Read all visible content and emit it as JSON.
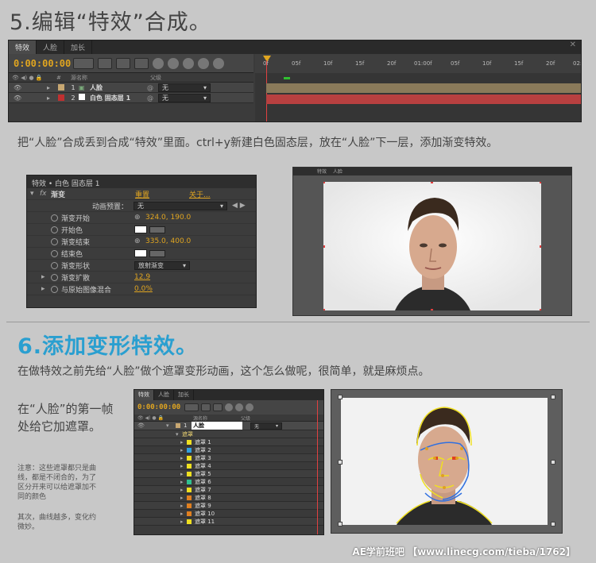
{
  "step5": {
    "title": "5.编辑“特效”合成。",
    "description": "把“人脸”合成丢到合成“特效”里面。ctrl+y新建白色固态层，放在“人脸”下一层，添加渐变特效。"
  },
  "timeline1": {
    "tabs": [
      "特效",
      "人脸",
      "加长"
    ],
    "timecode": "0:00:00:00",
    "col_source": "源名称",
    "col_parent": "父级",
    "ruler_ticks": [
      "0f",
      "05f",
      "10f",
      "15f",
      "20f",
      "01:00f",
      "05f",
      "10f",
      "15f",
      "20f",
      "02:0"
    ],
    "layers": [
      {
        "num": "1",
        "name": "人脸",
        "parent": "无",
        "color": "#c8a872",
        "track": "#8a7a5a"
      },
      {
        "num": "2",
        "name": "白色 固态层 1",
        "parent": "无",
        "color": "#c03030",
        "track": "#b84040"
      }
    ]
  },
  "effect_controls": {
    "header": "特效 • 白色 固态层 1",
    "effect_name": "渐变",
    "reset": "重置",
    "about": "关于...",
    "preset_label": "动画预置：",
    "preset_value": "无",
    "rows": [
      {
        "label": "渐变开始",
        "value": "324.0, 190.0",
        "kind": "point"
      },
      {
        "label": "开始色",
        "value": "",
        "kind": "color"
      },
      {
        "label": "渐变结束",
        "value": "335.0, 400.0",
        "kind": "point"
      },
      {
        "label": "结束色",
        "value": "",
        "kind": "color"
      },
      {
        "label": "渐变形状",
        "value": "放射渐变",
        "kind": "dropdown"
      },
      {
        "label": "渐变扩散",
        "value": "12.9",
        "kind": "num"
      },
      {
        "label": "与原始图像混合",
        "value": "0.0%",
        "kind": "num"
      }
    ]
  },
  "viewer1": {
    "tabs": [
      "特效",
      "人脸"
    ]
  },
  "step6": {
    "title": "6.添加变形特效。",
    "description": "在做特效之前先给“人脸”做个遮罩变形动画，这个怎么做呢，很简单，就是麻烦点。",
    "side_text": "在“人脸”的第一帧处给它加遮罩。",
    "note1": "注意：这些遮罩都只是曲线，都是不闭合的，为了区分开来可以给遮罩加不同的颜色",
    "note2": "其次，曲线越多，变化约微妙。"
  },
  "timeline2": {
    "tabs": [
      "特效",
      "人脸",
      "加长"
    ],
    "timecode": "0:00:00:00",
    "col_source": "源名称",
    "col_parent": "父级",
    "layer_name": "人脸",
    "layer_num": "1",
    "parent": "无",
    "mask_group": "遮罩",
    "masks": [
      {
        "name": "遮罩 1",
        "color": "#f0e020"
      },
      {
        "name": "遮罩 2",
        "color": "#30a0e0"
      },
      {
        "name": "遮罩 3",
        "color": "#f0e020"
      },
      {
        "name": "遮罩 4",
        "color": "#f0e020"
      },
      {
        "name": "遮罩 5",
        "color": "#f0e020"
      },
      {
        "name": "遮罩 6",
        "color": "#30c090"
      },
      {
        "name": "遮罩 7",
        "color": "#f0e020"
      },
      {
        "name": "遮罩 8",
        "color": "#e08020"
      },
      {
        "name": "遮罩 9",
        "color": "#e08020"
      },
      {
        "name": "遮罩 10",
        "color": "#e08020"
      },
      {
        "name": "遮罩 11",
        "color": "#f0e020"
      }
    ]
  },
  "footer": "AE学前班吧 【www.linecg.com/tieba/1762】",
  "colors": {
    "accent_blue": "#2a9fd0",
    "timecode": "#e0a520"
  }
}
